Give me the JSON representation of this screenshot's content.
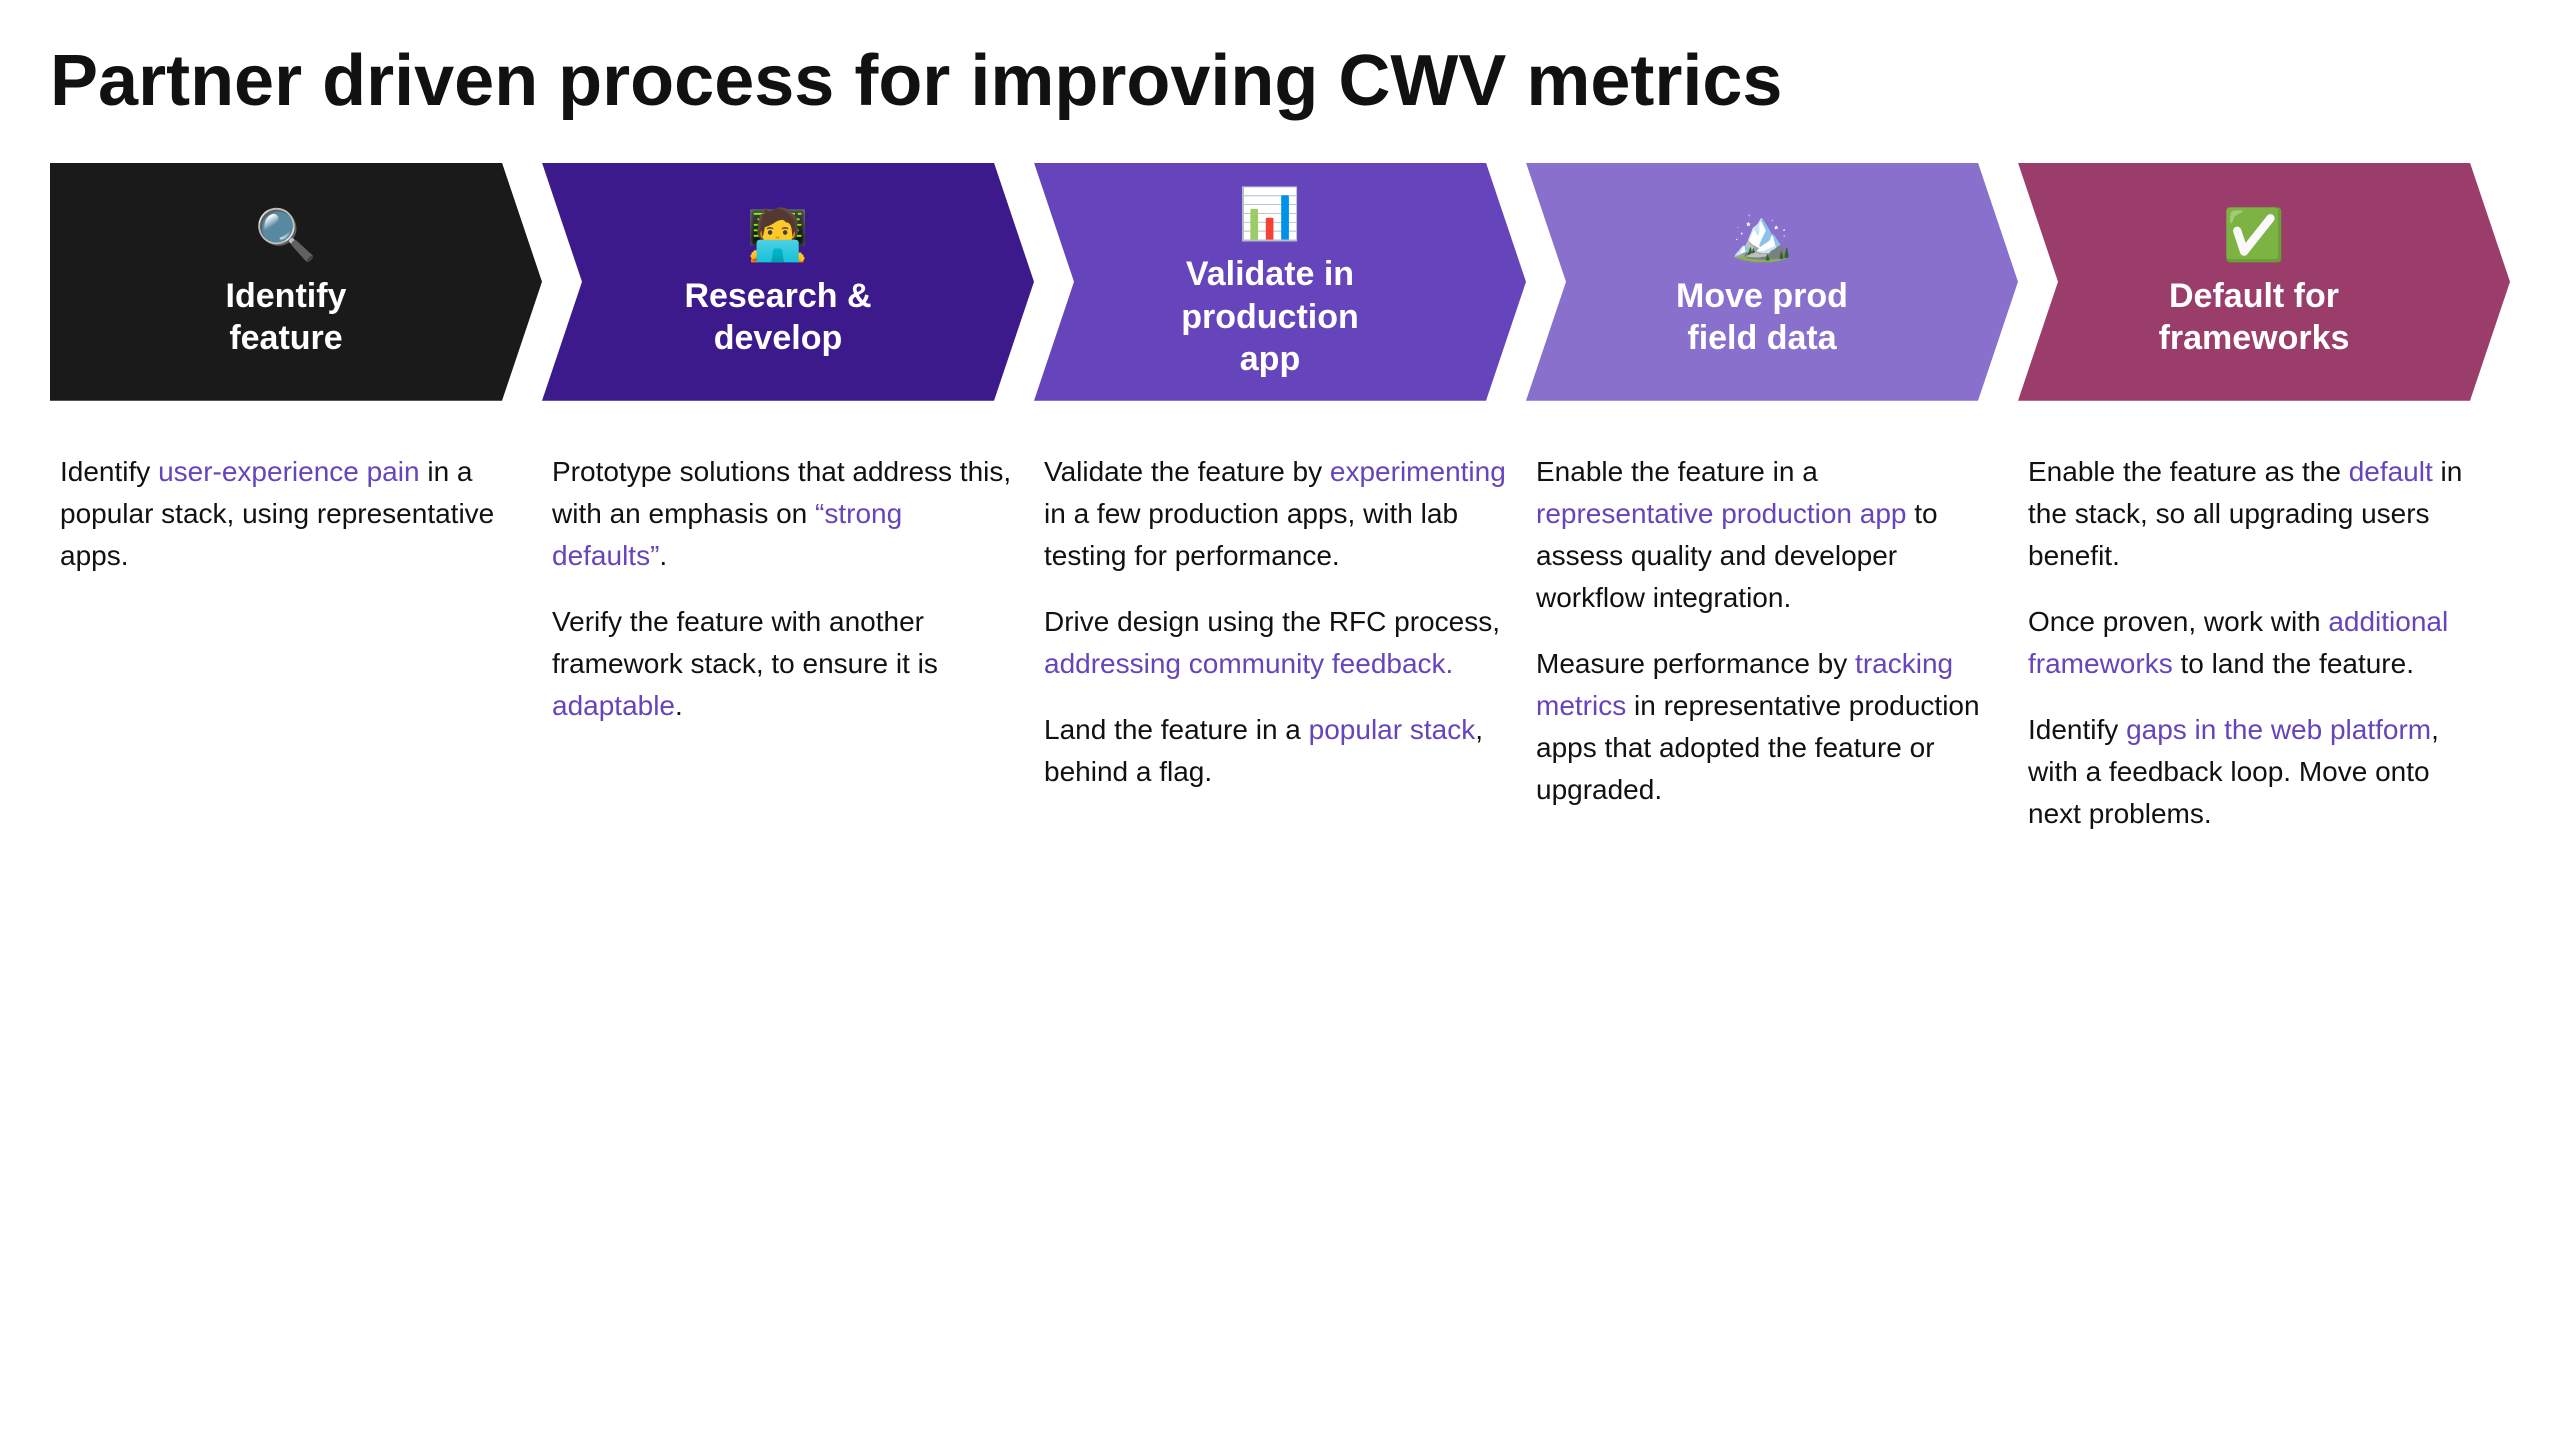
{
  "page": {
    "title": "Partner driven process for improving CWV metrics"
  },
  "steps": [
    {
      "id": "identify",
      "icon": "🔍",
      "label": "Identify\nfeature",
      "colorClass": "col-black",
      "content": [
        {
          "parts": [
            {
              "text": "Identify ",
              "type": "normal"
            },
            {
              "text": "user-experience pain",
              "type": "link-purple"
            },
            {
              "text": " in a popular stack, using representative apps.",
              "type": "normal"
            }
          ]
        }
      ]
    },
    {
      "id": "research",
      "icon": "🧑‍💻",
      "label": "Research &\ndevelop",
      "colorClass": "col-dpurple",
      "content": [
        {
          "parts": [
            {
              "text": "Prototype solutions that address this, with an emphasis on ",
              "type": "normal"
            },
            {
              "text": "“strong defaults”",
              "type": "link-purple"
            },
            {
              "text": ".",
              "type": "normal"
            }
          ]
        },
        {
          "parts": [
            {
              "text": "Verify the feature with another framework stack, to ensure it is ",
              "type": "normal"
            },
            {
              "text": "adaptable",
              "type": "link-purple"
            },
            {
              "text": ".",
              "type": "normal"
            }
          ]
        }
      ]
    },
    {
      "id": "validate",
      "icon": "📊",
      "label": "Validate in\nproduction\napp",
      "colorClass": "col-mpurple",
      "content": [
        {
          "parts": [
            {
              "text": "Validate the feature by ",
              "type": "normal"
            },
            {
              "text": "experimenting",
              "type": "link-purple"
            },
            {
              "text": " in a few production apps, with lab testing for performance.",
              "type": "normal"
            }
          ]
        },
        {
          "parts": [
            {
              "text": "Drive design using the RFC process, ",
              "type": "normal"
            },
            {
              "text": "addressing community feedback.",
              "type": "link-purple"
            }
          ]
        },
        {
          "parts": [
            {
              "text": "Land the feature in a ",
              "type": "normal"
            },
            {
              "text": "popular stack",
              "type": "link-purple"
            },
            {
              "text": ", behind a flag.",
              "type": "normal"
            }
          ]
        }
      ]
    },
    {
      "id": "move",
      "icon": "🏔️",
      "label": "Move prod\nfield data",
      "colorClass": "col-lpurple",
      "content": [
        {
          "parts": [
            {
              "text": "Enable the feature in a ",
              "type": "normal"
            },
            {
              "text": "representative production app",
              "type": "link-purple"
            },
            {
              "text": " to assess quality and developer workflow integration.",
              "type": "normal"
            }
          ]
        },
        {
          "parts": [
            {
              "text": "Measure performance by ",
              "type": "normal"
            },
            {
              "text": "tracking metrics",
              "type": "link-purple"
            },
            {
              "text": " in representative production apps that adopted the feature or upgraded.",
              "type": "normal"
            }
          ]
        }
      ]
    },
    {
      "id": "default",
      "icon": "✅",
      "label": "Default for\nframeworks",
      "colorClass": "col-mauve",
      "content": [
        {
          "parts": [
            {
              "text": "Enable the feature as the ",
              "type": "normal"
            },
            {
              "text": "default",
              "type": "link-purple"
            },
            {
              "text": " in the stack, so all upgrading users benefit.",
              "type": "normal"
            }
          ]
        },
        {
          "parts": [
            {
              "text": "Once proven, work with ",
              "type": "normal"
            },
            {
              "text": "additional frameworks",
              "type": "link-purple"
            },
            {
              "text": " to land the feature.",
              "type": "normal"
            }
          ]
        },
        {
          "parts": [
            {
              "text": "Identify ",
              "type": "normal"
            },
            {
              "text": "gaps in the web platform",
              "type": "link-purple"
            },
            {
              "text": ", with a feedback loop. Move onto next problems.",
              "type": "normal"
            }
          ]
        }
      ]
    }
  ]
}
